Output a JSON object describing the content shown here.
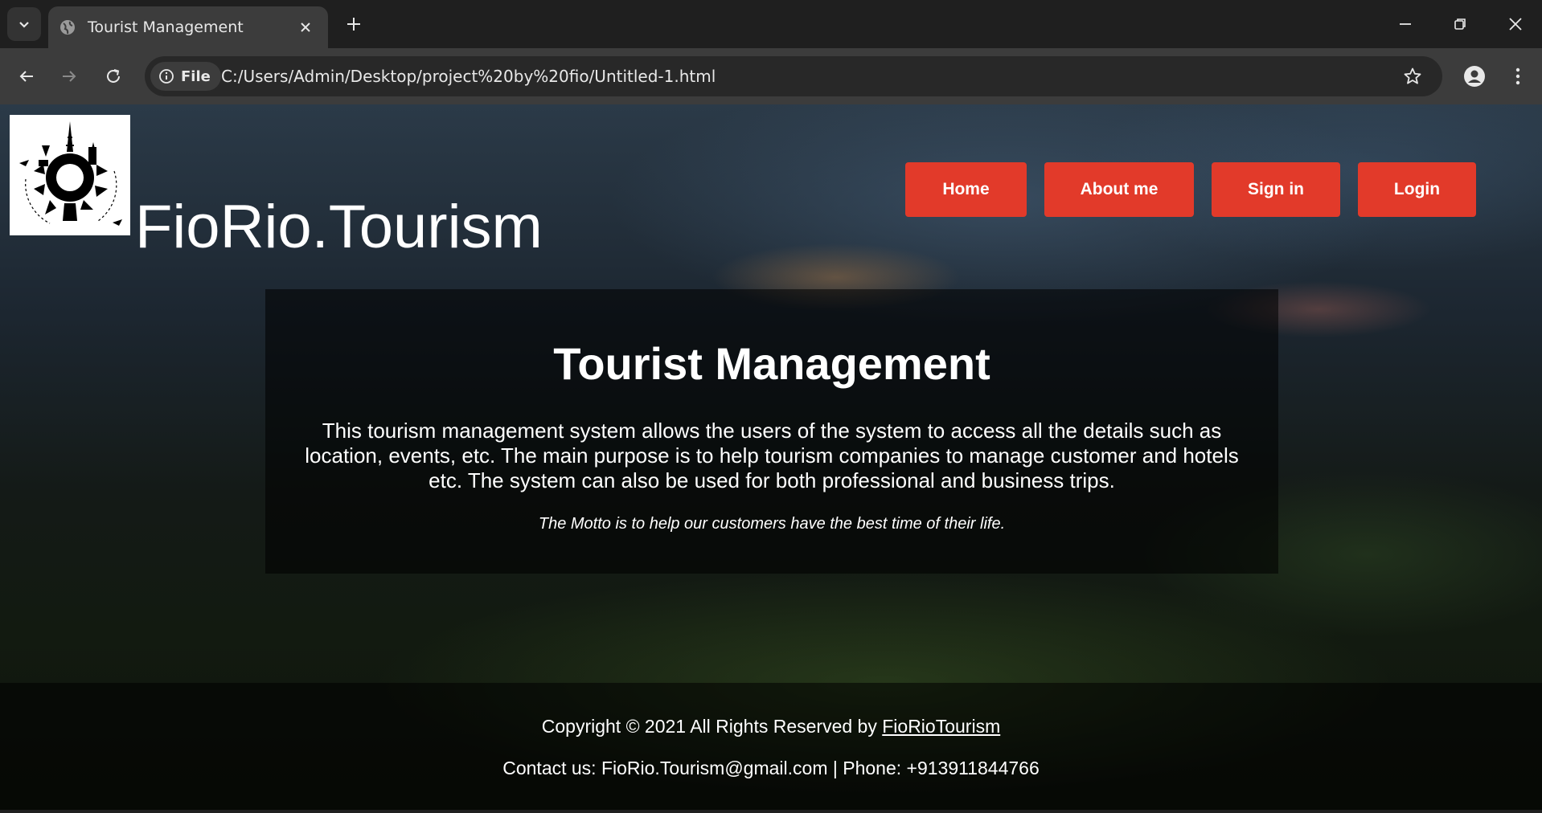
{
  "browser": {
    "tab_title": "Tourist Management",
    "file_chip_label": "File",
    "url": "C:/Users/Admin/Desktop/project%20by%20fio/Untitled-1.html",
    "icons": [
      "chevron-down-icon",
      "globe-icon",
      "close-icon",
      "plus-icon",
      "minimize-icon",
      "restore-icon",
      "close-icon",
      "back-icon",
      "forward-icon",
      "reload-icon",
      "info-icon",
      "star-icon",
      "profile-icon",
      "more-vert-icon"
    ]
  },
  "header": {
    "brand": "FioRio.Tourism",
    "nav": [
      {
        "label": "Home"
      },
      {
        "label": "About me"
      },
      {
        "label": "Sign in"
      },
      {
        "label": "Login"
      }
    ],
    "nav_color": "#e23a2a"
  },
  "hero": {
    "title": "Tourist Management",
    "description": "This tourism management system allows the users of the system to access all the details such as location, events, etc. The main purpose is to help tourism companies to manage customer and hotels etc. The system can also be used for both professional and business trips.",
    "motto": "The Motto is to help our customers have the best time of their life."
  },
  "footer": {
    "copyright_prefix": "Copyright © 2021 All Rights Reserved by ",
    "copyright_link": "FioRioTourism",
    "contact": "Contact us: FioRio.Tourism@gmail.com | Phone: +913911844766"
  }
}
